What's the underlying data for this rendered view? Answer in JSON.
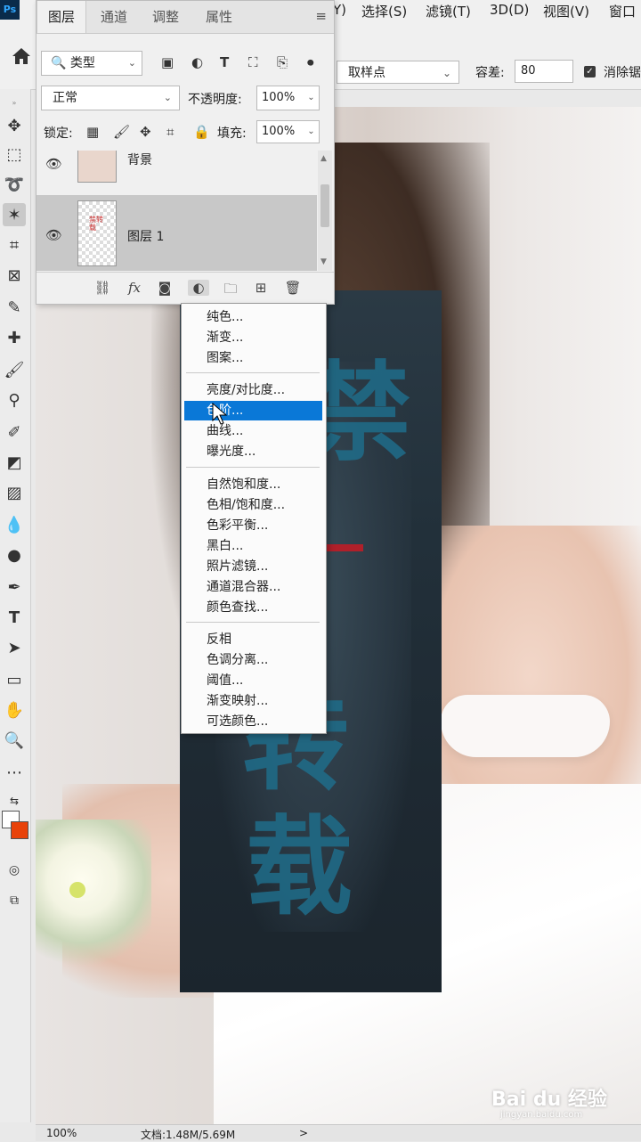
{
  "menubar": {
    "logo": "Ps",
    "items": [
      "Y)",
      "选择(S)",
      "滤镜(T)",
      "3D(D)",
      "视图(V)",
      "窗口"
    ]
  },
  "options": {
    "sample_value": "取样点",
    "tolerance_label": "容差:",
    "tolerance_value": "80",
    "antialias_label": "消除锯"
  },
  "layers_panel": {
    "tabs": [
      "图层",
      "通道",
      "调整",
      "属性"
    ],
    "filter_value": "类型",
    "blend_mode": "正常",
    "opacity_label": "不透明度:",
    "opacity_value": "100%",
    "lock_label": "锁定:",
    "fill_label": "填充:",
    "fill_value": "100%",
    "layers": [
      {
        "name": "背景",
        "visible": true,
        "selected": false
      },
      {
        "name": "图层 1",
        "visible": true,
        "selected": true
      }
    ]
  },
  "adjust_menu": {
    "groups": [
      [
        "纯色...",
        "渐变...",
        "图案..."
      ],
      [
        "亮度/对比度...",
        "色阶...",
        "曲线...",
        "曝光度..."
      ],
      [
        "自然饱和度...",
        "色相/饱和度...",
        "色彩平衡...",
        "黑白...",
        "照片滤镜...",
        "通道混合器...",
        "颜色查找..."
      ],
      [
        "反相",
        "色调分离...",
        "阈值...",
        "渐变映射...",
        "可选颜色..."
      ]
    ],
    "highlighted": "色阶..."
  },
  "canvas": {
    "poster_chars": [
      "禁",
      "转",
      "载"
    ]
  },
  "status": {
    "zoom": "100%",
    "doc": "文档:1.48M/5.69M",
    "arrow": ">"
  },
  "watermark": {
    "logo": "Bai du 经验",
    "url": "jingyan.baidu.com"
  },
  "colors": {
    "accent": "#0a78d7",
    "foreground": "#ffffff",
    "background": "#e8420a"
  }
}
